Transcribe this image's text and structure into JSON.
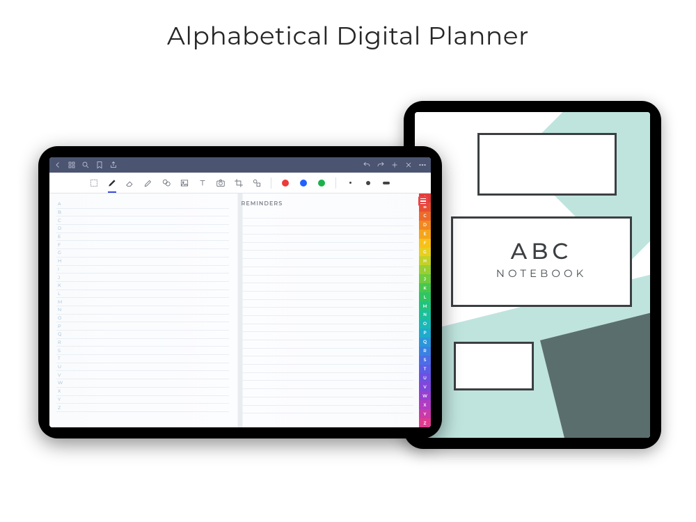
{
  "title": "Alphabetical Digital Planner",
  "cover": {
    "abc": "ABC",
    "notebook": "NOTEBOOK"
  },
  "app": {
    "reminders_header": "REMINDERS",
    "letters": [
      "A",
      "B",
      "C",
      "D",
      "E",
      "F",
      "G",
      "H",
      "I",
      "J",
      "K",
      "L",
      "M",
      "N",
      "O",
      "P",
      "Q",
      "R",
      "S",
      "T",
      "U",
      "V",
      "W",
      "X",
      "Y",
      "Z"
    ],
    "tool_colors": {
      "red": "#ed3a3a",
      "blue": "#1f62ff",
      "green": "#1bb24b"
    },
    "toolbar_icons": [
      "select",
      "pen",
      "eraser",
      "highlighter",
      "lasso",
      "image",
      "text",
      "camera",
      "crop",
      "shapes"
    ],
    "appbar_left_icons": [
      "back",
      "grid",
      "search",
      "bookmark",
      "share"
    ],
    "appbar_right_icons": [
      "undo",
      "redo",
      "add",
      "close",
      "more"
    ],
    "tab_colors": [
      "#e33c3c",
      "#e84f32",
      "#ee6a2a",
      "#f28821",
      "#f6a51b",
      "#f9c018",
      "#e9cf20",
      "#c3d128",
      "#99cf32",
      "#6fcb3f",
      "#48c74d",
      "#2fc562",
      "#22c37f",
      "#1bbf9b",
      "#1ab9b5",
      "#1eabcc",
      "#2a97da",
      "#3a82e2",
      "#4b6ee6",
      "#5c5de6",
      "#6e50e1",
      "#8146da",
      "#9740cf",
      "#b03cc1",
      "#c93aab",
      "#df3c8f"
    ]
  }
}
